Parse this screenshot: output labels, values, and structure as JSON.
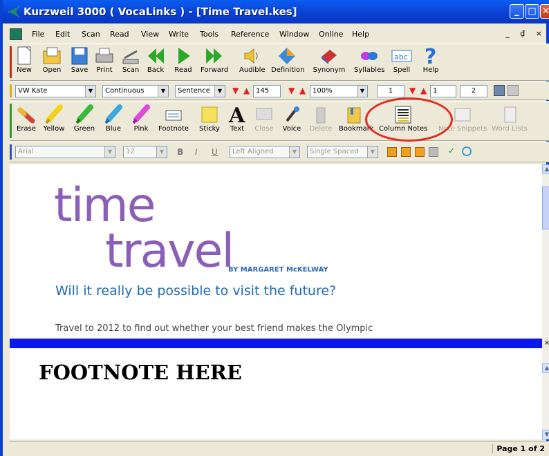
{
  "window": {
    "title": "Kurzweil 3000 ( VocaLinks ) - [Time Travel.kes]",
    "minimize": "_",
    "maximize": "□",
    "close": "✕",
    "mdi_controls": "_ ₫ ×"
  },
  "menu": [
    "File",
    "Edit",
    "Scan",
    "Read",
    "View",
    "Write",
    "Tools",
    "Reference",
    "Window",
    "Online",
    "Help"
  ],
  "toolbar1": [
    {
      "label": "New",
      "icon": "new-document-icon"
    },
    {
      "label": "Open",
      "icon": "open-folder-icon"
    },
    {
      "label": "Save",
      "icon": "save-disk-icon"
    },
    {
      "label": "Print",
      "icon": "printer-icon"
    },
    {
      "label": "Scan",
      "icon": "scanner-icon"
    },
    {
      "label": "Back",
      "icon": "back-arrow-icon"
    },
    {
      "label": "Read",
      "icon": "play-icon"
    },
    {
      "label": "Forward",
      "icon": "forward-arrow-icon"
    },
    {
      "label": "Audible",
      "icon": "speaker-icon"
    },
    {
      "label": "Definition",
      "icon": "definition-icon"
    },
    {
      "label": "Synonym",
      "icon": "synonym-book-icon"
    },
    {
      "label": "Syllables",
      "icon": "syllables-icon"
    },
    {
      "label": "Spell",
      "icon": "spell-abc-icon"
    },
    {
      "label": "Help",
      "icon": "help-question-icon"
    }
  ],
  "toolbar2": {
    "voice": "VW Kate",
    "mode": "Continuous",
    "unit": "Sentence",
    "speed": "145",
    "zoom": "100%",
    "page": "1",
    "page2": "1",
    "total": "2"
  },
  "toolbar3": [
    {
      "label": "Erase",
      "icon": "eraser-icon"
    },
    {
      "label": "Yellow",
      "icon": "yellow-highlighter-icon"
    },
    {
      "label": "Green",
      "icon": "green-highlighter-icon"
    },
    {
      "label": "Blue",
      "icon": "blue-highlighter-icon"
    },
    {
      "label": "Pink",
      "icon": "pink-highlighter-icon"
    },
    {
      "label": "Footnote",
      "icon": "footnote-icon"
    },
    {
      "label": "Sticky",
      "icon": "sticky-note-icon"
    },
    {
      "label": "Text",
      "icon": "text-A-icon"
    },
    {
      "label": "Close",
      "icon": "close-note-icon"
    },
    {
      "label": "Voice",
      "icon": "microphone-icon"
    },
    {
      "label": "Delete",
      "icon": "delete-icon"
    },
    {
      "label": "Bookmark",
      "icon": "bookmark-icon"
    },
    {
      "label": "Column Notes",
      "icon": "column-notes-icon"
    },
    {
      "label": "Note Snippets",
      "icon": "note-snippets-icon"
    },
    {
      "label": "Word Lists",
      "icon": "word-lists-icon"
    }
  ],
  "toolbar4": {
    "font": "Arial",
    "size": "12",
    "bold": "B",
    "italic": "I",
    "underline": "U",
    "align": "Left Aligned",
    "spacing": "Single Spaced"
  },
  "document": {
    "title_line1": "time",
    "title_line2": "travel",
    "byline": "BY MARGARET McKELWAY",
    "subtitle": "Will it really be possible to visit the future?",
    "lead": "Travel to 2012 to find out whether your best friend makes the Olympic"
  },
  "footnote": {
    "text": "FOOTNOTE HERE"
  },
  "status": {
    "page": "Page 1 of 2"
  },
  "colors": {
    "title_bar": "#0a4fe0",
    "title_text": "#8b5fb8",
    "subtitle": "#1f6bb9",
    "splitter": "#0a18e8",
    "highlight_circle": "#e52a1c"
  }
}
